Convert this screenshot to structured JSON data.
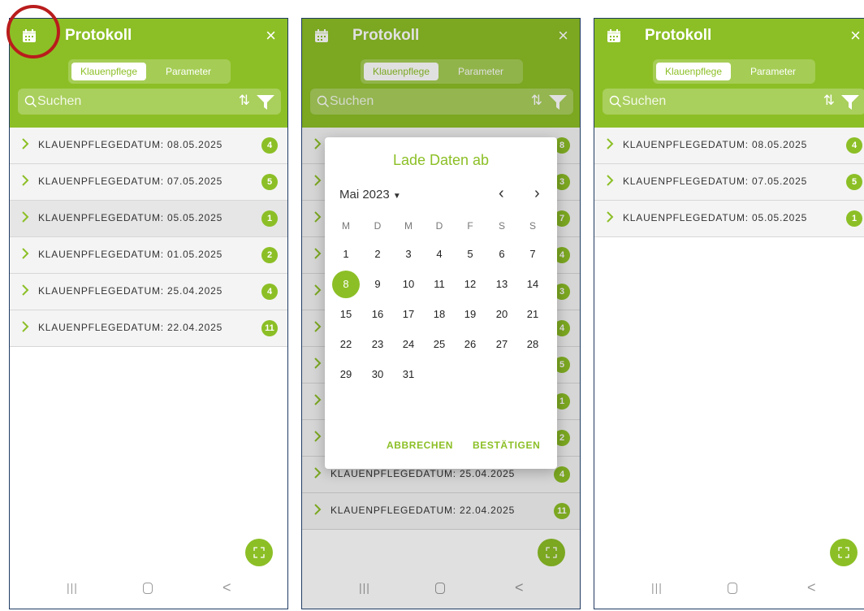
{
  "app": {
    "title": "Protokoll",
    "close": "×",
    "tabs": [
      "Klauenpflege",
      "Parameter"
    ],
    "search_placeholder": "Suchen",
    "sort_icon": "⇅",
    "accent_color": "#8cbf26",
    "highlight_color": "#b91c1c"
  },
  "screen1": {
    "rows": [
      {
        "label": "KLAUENPFLEGEDATUM: 08.05.2025",
        "count": "4"
      },
      {
        "label": "KLAUENPFLEGEDATUM: 07.05.2025",
        "count": "5"
      },
      {
        "label": "KLAUENPFLEGEDATUM: 05.05.2025",
        "count": "1"
      },
      {
        "label": "KLAUENPFLEGEDATUM: 01.05.2025",
        "count": "2"
      },
      {
        "label": "KLAUENPFLEGEDATUM: 25.04.2025",
        "count": "4"
      },
      {
        "label": "KLAUENPFLEGEDATUM: 22.04.2025",
        "count": "11"
      }
    ]
  },
  "screen2": {
    "background_badges": [
      "8",
      "3",
      "7",
      "4",
      "3",
      "4",
      "5",
      "1",
      "2"
    ],
    "rows_visible": [
      {
        "label": "KLAUENPFLEGEDATUM: 25.04.2025",
        "count": "4"
      },
      {
        "label": "KLAUENPFLEGEDATUM: 22.04.2025",
        "count": "11"
      }
    ],
    "dialog": {
      "title": "Lade Daten ab",
      "month": "Mai 2023",
      "prev": "‹",
      "next": "›",
      "weekdays": [
        "M",
        "D",
        "M",
        "D",
        "F",
        "S",
        "S"
      ],
      "weeks": [
        [
          "1",
          "2",
          "3",
          "4",
          "5",
          "6",
          "7"
        ],
        [
          "8",
          "9",
          "10",
          "11",
          "12",
          "13",
          "14"
        ],
        [
          "15",
          "16",
          "17",
          "18",
          "19",
          "20",
          "21"
        ],
        [
          "22",
          "23",
          "24",
          "25",
          "26",
          "27",
          "28"
        ],
        [
          "29",
          "30",
          "31"
        ]
      ],
      "selected_day": "8",
      "cancel": "ABBRECHEN",
      "confirm": "BESTÄTIGEN"
    }
  },
  "screen3": {
    "rows": [
      {
        "label": "KLAUENPFLEGEDATUM: 08.05.2025",
        "count": "4"
      },
      {
        "label": "KLAUENPFLEGEDATUM: 07.05.2025",
        "count": "5"
      },
      {
        "label": "KLAUENPFLEGEDATUM: 05.05.2025",
        "count": "1"
      }
    ]
  },
  "nav": {
    "recent": "|||",
    "back": "<"
  }
}
